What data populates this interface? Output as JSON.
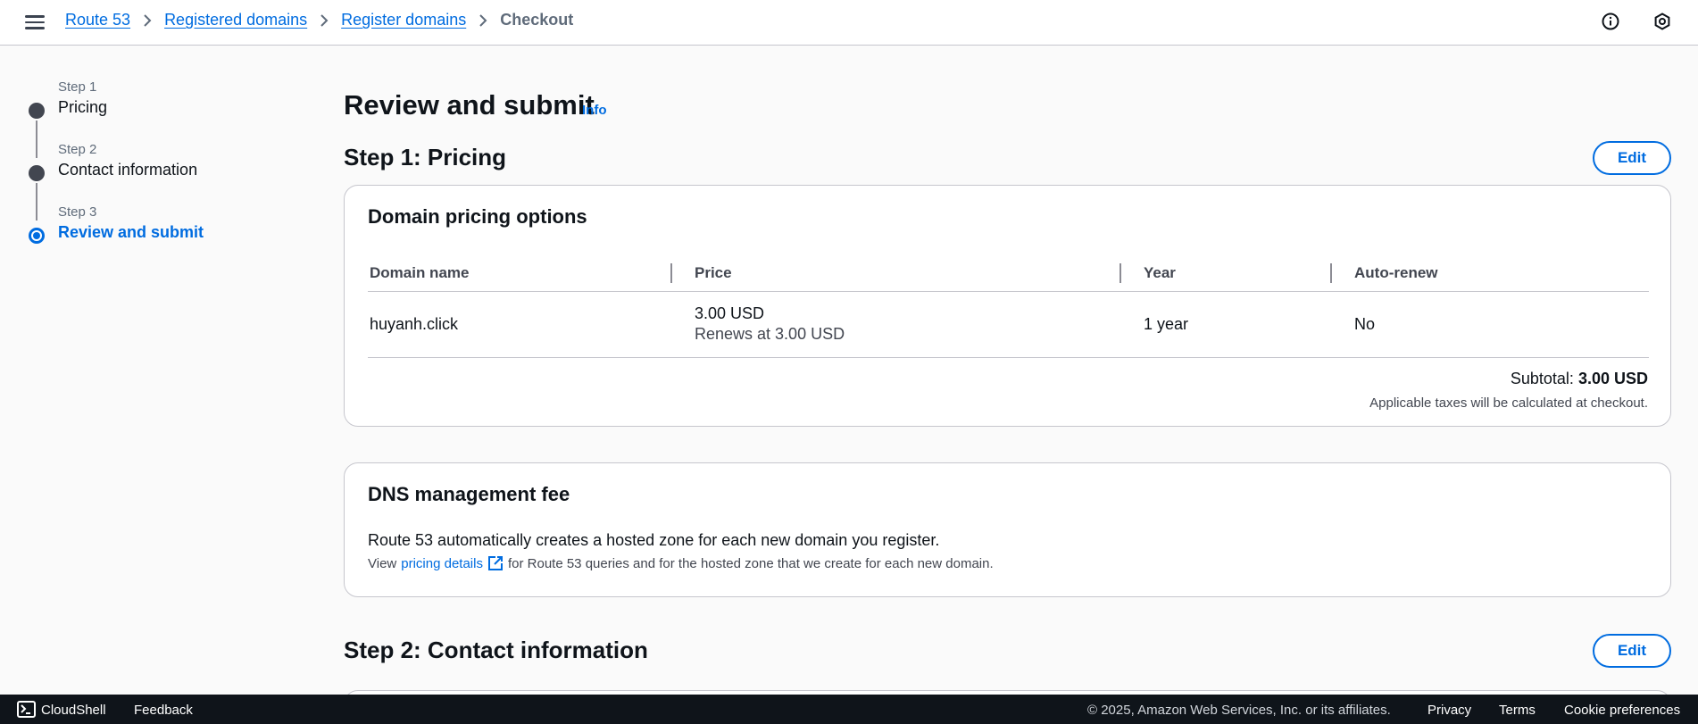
{
  "topbar": {
    "menu_icon": "hamburger-menu-icon",
    "breadcrumbs": [
      "Route 53",
      "Registered domains",
      "Register domains"
    ],
    "current": "Checkout",
    "info_icon": "info-circle-icon",
    "settings_icon": "settings-icon"
  },
  "steps": [
    {
      "num": "Step 1",
      "title": "Pricing"
    },
    {
      "num": "Step 2",
      "title": "Contact information"
    },
    {
      "num": "Step 3",
      "title": "Review and submit"
    }
  ],
  "main": {
    "title": "Review and submit",
    "info": "Info",
    "step1": {
      "header": "Step 1: Pricing",
      "edit": "Edit",
      "card_title": "Domain pricing options",
      "columns": [
        "Domain name",
        "Price",
        "Year",
        "Auto-renew"
      ],
      "row": {
        "domain": "huyanh.click",
        "price": "3.00 USD",
        "renews": "Renews at 3.00 USD",
        "year": "1 year",
        "auto_renew": "No"
      },
      "subtotal_label": "Subtotal:",
      "subtotal_value": "3.00 USD",
      "tax_note": "Applicable taxes will be calculated at checkout."
    },
    "dns": {
      "title": "DNS management fee",
      "text": "Route 53 automatically creates a hosted zone for each new domain you register.",
      "view": "View",
      "link": "pricing details",
      "link_icon": "external-link-icon",
      "rest": "for Route 53 queries and for the hosted zone that we create for each new domain."
    },
    "step2": {
      "header": "Step 2: Contact information",
      "edit": "Edit"
    }
  },
  "footer": {
    "cloudshell": "CloudShell",
    "feedback": "Feedback",
    "copyright": "© 2025, Amazon Web Services, Inc. or its affiliates.",
    "privacy": "Privacy",
    "terms": "Terms",
    "cookies": "Cookie preferences"
  },
  "colors": {
    "accent": "#006ce0",
    "footer_bg": "#0f141a"
  }
}
